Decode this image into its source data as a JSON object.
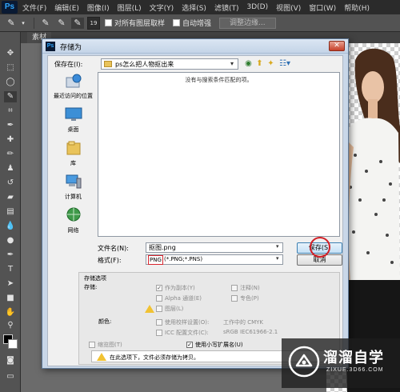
{
  "app": {
    "logo": "Ps",
    "menu": [
      "文件(F)",
      "编辑(E)",
      "图像(I)",
      "图层(L)",
      "文字(Y)",
      "选择(S)",
      "滤镜(T)",
      "3D(D)",
      "视图(V)",
      "窗口(W)",
      "帮助(H)"
    ]
  },
  "options_bar": {
    "brush_size": "19",
    "sample_all_label": "对所有图层取样",
    "auto_enhance_label": "自动增强",
    "refine_edge_label": "调整边缘..."
  },
  "document_tab": "素材",
  "dialog": {
    "title": "存储为",
    "close_label": "✕",
    "save_in_label": "保存在(I):",
    "location": "ps怎么把人物抠出来",
    "places": [
      {
        "label": "最近访问的位置",
        "icon": "recent-places-icon"
      },
      {
        "label": "桌面",
        "icon": "desktop-icon"
      },
      {
        "label": "库",
        "icon": "libraries-icon"
      },
      {
        "label": "计算机",
        "icon": "computer-icon"
      },
      {
        "label": "网络",
        "icon": "network-icon"
      }
    ],
    "empty_message": "没有与搜索条件匹配的项。",
    "filename_label": "文件名(N):",
    "filename_value": "抠图.png",
    "format_label": "格式(F):",
    "format_ext": "PNG",
    "format_desc": "(*.PNG;*.PNS)",
    "save_button": "保存(S)",
    "cancel_button": "取消",
    "options": {
      "section_title": "存储选项",
      "save_label": "存储:",
      "as_copy": "作为副本(Y)",
      "notes": "注释(N)",
      "alpha_channels": "Alpha 通道(E)",
      "spot_colors": "专色(P)",
      "layers": "图层(L)",
      "color_label": "颜色:",
      "use_proof_setup": "使用校样设置(O):",
      "proof_value": "工作中的 CMYK",
      "icc_profile": "ICC 配置文件(C):",
      "icc_value": "sRGB IEC61966-2.1",
      "thumbnail": "缩览图(T)",
      "lowercase_ext": "使用小写扩展名(U)",
      "warning": "在此选项下，文件必须存储为拷贝。"
    }
  },
  "watermark": {
    "title": "溜溜自学",
    "url": "ZIXUE.3D66.COM"
  },
  "colors": {
    "highlight_red": "#d21f26",
    "dialog_frame": "#c9d7e8",
    "ps_blue": "#31a8ff"
  }
}
